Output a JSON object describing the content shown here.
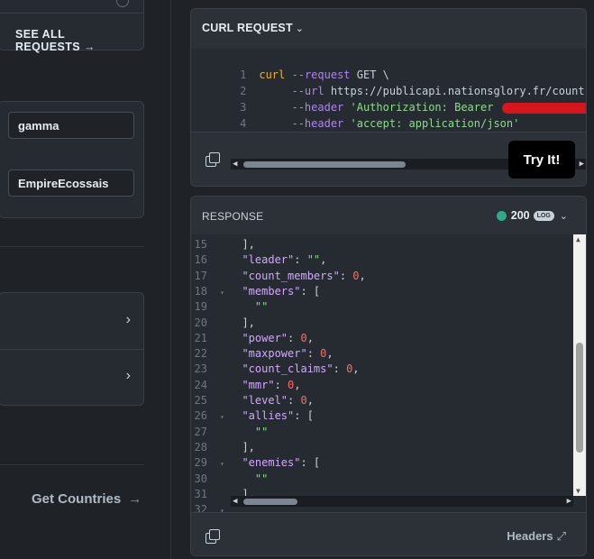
{
  "sidebar": {
    "see_all_label": "SEE ALL REQUESTS",
    "see_all_arrow": "→",
    "param_1_value": "gamma",
    "param_2_value": "EmpireEcossais",
    "chevron": "›",
    "next_link_label": "Get Countries",
    "next_link_arrow": "→"
  },
  "request": {
    "title": "CURL REQUEST",
    "caret": "⌄",
    "lines": [
      {
        "n": "1",
        "cmd": "curl",
        "opt": "--request",
        "rest": " GET \\"
      },
      {
        "n": "2",
        "opt": "--url",
        "rest": " https://publicapi.nationsglory.fr/country/ga"
      },
      {
        "n": "3",
        "opt": "--header",
        "str": " 'Authorization: Bearer "
      },
      {
        "n": "4",
        "opt": "--header",
        "str": " 'accept: application/json'"
      }
    ],
    "try_label": "Try It!"
  },
  "response": {
    "title": "RESPONSE",
    "status_code": "200",
    "log_badge": "LOG",
    "caret": "⌄",
    "lines": [
      {
        "n": "15",
        "fold": "",
        "text": "  ],"
      },
      {
        "n": "16",
        "fold": "",
        "key": "\"leader\"",
        "sep": ": ",
        "str": "\"\"",
        "end": ","
      },
      {
        "n": "17",
        "fold": "",
        "key": "\"count_members\"",
        "sep": ": ",
        "num": "0",
        "end": ","
      },
      {
        "n": "18",
        "fold": "▾",
        "key": "\"members\"",
        "sep": ": [",
        "end": ""
      },
      {
        "n": "19",
        "fold": "",
        "str2": "\"\""
      },
      {
        "n": "20",
        "fold": "",
        "text": "  ],"
      },
      {
        "n": "21",
        "fold": "",
        "key": "\"power\"",
        "sep": ": ",
        "num": "0",
        "end": ","
      },
      {
        "n": "22",
        "fold": "",
        "key": "\"maxpower\"",
        "sep": ": ",
        "num": "0",
        "end": ","
      },
      {
        "n": "23",
        "fold": "",
        "key": "\"count_claims\"",
        "sep": ": ",
        "num": "0",
        "end": ","
      },
      {
        "n": "24",
        "fold": "",
        "key": "\"mmr\"",
        "sep": ": ",
        "num": "0",
        "end": ","
      },
      {
        "n": "25",
        "fold": "",
        "key": "\"level\"",
        "sep": ": ",
        "num": "0",
        "end": ","
      },
      {
        "n": "26",
        "fold": "▾",
        "key": "\"allies\"",
        "sep": ": [",
        "end": ""
      },
      {
        "n": "27",
        "fold": "",
        "str2": "\"\""
      },
      {
        "n": "28",
        "fold": "",
        "text": "  ],"
      },
      {
        "n": "29",
        "fold": "▾",
        "key": "\"enemies\"",
        "sep": ": [",
        "end": ""
      },
      {
        "n": "30",
        "fold": "",
        "str2": "\"\""
      },
      {
        "n": "31",
        "fold": "",
        "text": "  ],"
      },
      {
        "n": "32",
        "fold": "▾",
        "text": ""
      }
    ],
    "headers_label": "Headers",
    "expand_glyph": "⤢"
  }
}
